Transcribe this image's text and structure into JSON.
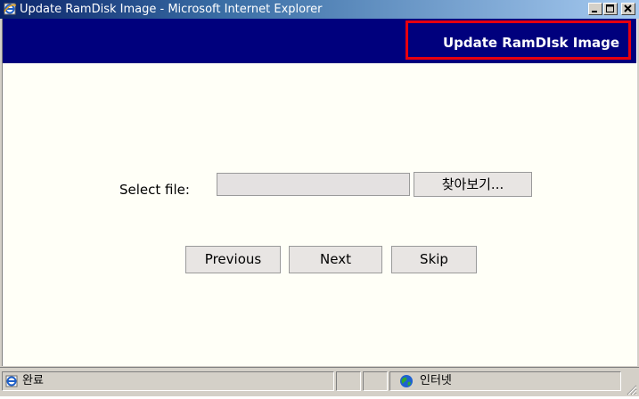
{
  "window": {
    "title": "Update RamDisk Image - Microsoft Internet Explorer"
  },
  "page": {
    "header_title": "Update RamDIsk Image",
    "select_file_label": "Select file:",
    "file_input_value": "",
    "browse_button_label": "찾아보기...",
    "buttons": {
      "previous": "Previous",
      "next": "Next",
      "skip": "Skip"
    }
  },
  "statusbar": {
    "status_text": "완료",
    "zone_text": "인터넷"
  },
  "colors": {
    "header_background": "#00007d",
    "header_highlight_border": "#e8000e",
    "page_background": "#fffff7",
    "title_bar_start": "#0a246a"
  },
  "icons": {
    "app": "ie-page-icon",
    "minimize": "minimize-icon",
    "maximize": "maximize-icon",
    "close": "close-icon",
    "status": "ie-status-icon",
    "zone": "globe-icon",
    "grip": "resize-grip-icon"
  }
}
